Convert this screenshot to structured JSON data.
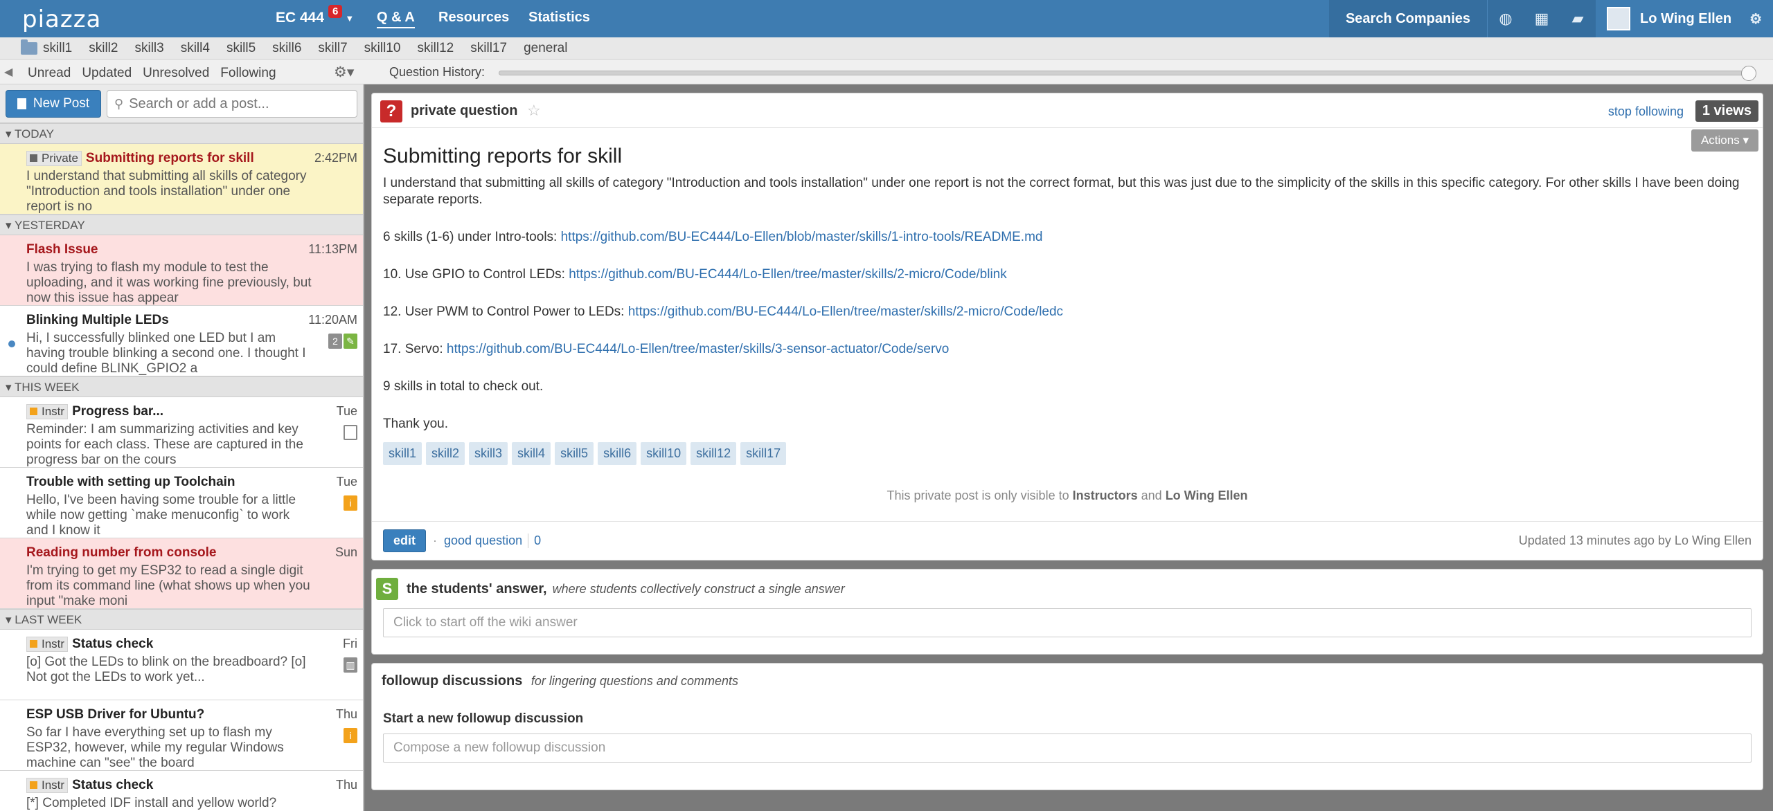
{
  "topbar": {
    "logo": "piazza",
    "course": "EC 444",
    "notif_count": "6",
    "nav": [
      "Q & A",
      "Resources",
      "Statistics"
    ],
    "search_companies": "Search Companies",
    "user_name": "Lo Wing Ellen"
  },
  "folders": [
    "skill1",
    "skill2",
    "skill3",
    "skill4",
    "skill5",
    "skill6",
    "skill7",
    "skill10",
    "skill12",
    "skill17",
    "general"
  ],
  "filters": [
    "Unread",
    "Updated",
    "Unresolved",
    "Following"
  ],
  "question_history_label": "Question History:",
  "sidebar": {
    "new_post": "New Post",
    "search_placeholder": "Search or add a post...",
    "groups": {
      "today": "TODAY",
      "yesterday": "YESTERDAY",
      "this_week": "THIS WEEK",
      "last_week": "LAST WEEK"
    },
    "posts": [
      {
        "tag": "Private",
        "title": "Submitting reports for skill",
        "snippet": "I understand that submitting all skills of category \"Introduction and tools installation\" under one report is no",
        "time": "2:42PM"
      },
      {
        "title": "Flash Issue",
        "snippet": "I was trying to flash my module to test the uploading, and it was working fine previously, but now this issue has appear",
        "time": "11:13PM"
      },
      {
        "title": "Blinking Multiple LEDs",
        "snippet": "Hi, I successfully blinked one LED but I am having trouble blinking a second one. I thought I could define BLINK_GPIO2 a",
        "time": "11:20AM",
        "count": "2"
      },
      {
        "tag": "Instr",
        "title": "Progress bar...",
        "snippet": "Reminder: I am summarizing activities and key points for each class. These are captured in the progress bar on the cours",
        "time": "Tue"
      },
      {
        "title": "Trouble with setting up Toolchain",
        "snippet": "Hello, I've been having some trouble for a little while now getting `make menuconfig` to work and I know it",
        "time": "Tue"
      },
      {
        "title": "Reading number from console",
        "snippet": "I'm trying to get my ESP32 to read a single digit from its command line (what shows up when you input \"make moni",
        "time": "Sun"
      },
      {
        "tag": "Instr",
        "title": "Status check",
        "snippet": "[o] Got the LEDs to blink on the breadboard? [o] Not got the LEDs to work yet...",
        "time": "Fri"
      },
      {
        "title": "ESP USB Driver for Ubuntu?",
        "snippet": "So far I have everything set up to flash my ESP32, however, while my regular Windows machine can \"see\" the board",
        "time": "Thu"
      },
      {
        "tag": "Instr",
        "title": "Status check",
        "snippet": "[*] Completed IDF install and yellow world?",
        "time": "Thu"
      }
    ]
  },
  "question": {
    "type": "private question",
    "stop_following": "stop following",
    "views": "1 views",
    "actions": "Actions",
    "title": "Submitting reports for skill",
    "intro": "I understand that submitting all skills of category \"Introduction and tools installation\" under one report is not the correct format, but this was just due to the simplicity of the skills in this specific category. For other skills I have been doing separate reports.",
    "lines": [
      {
        "label": "6 skills (1-6) under Intro-tools: ",
        "link": "https://github.com/BU-EC444/Lo-Ellen/blob/master/skills/1-intro-tools/README.md"
      },
      {
        "label": "10. Use GPIO to Control LEDs: ",
        "link": "https://github.com/BU-EC444/Lo-Ellen/tree/master/skills/2-micro/Code/blink"
      },
      {
        "label": "12. User PWM to Control Power to LEDs: ",
        "link": "https://github.com/BU-EC444/Lo-Ellen/tree/master/skills/2-micro/Code/ledc"
      },
      {
        "label": "17. Servo: ",
        "link": "https://github.com/BU-EC444/Lo-Ellen/tree/master/skills/3-sensor-actuator/Code/servo"
      }
    ],
    "total": "9 skills in total to check out.",
    "thanks": "Thank you.",
    "tags": [
      "skill1",
      "skill2",
      "skill3",
      "skill4",
      "skill5",
      "skill6",
      "skill10",
      "skill12",
      "skill17"
    ],
    "private_note": {
      "pre": "This private post is only visible to ",
      "who1": "Instructors",
      "mid": " and ",
      "who2": "Lo Wing Ellen"
    },
    "edit": "edit",
    "good_question": "good question",
    "good_count": "0",
    "updated": "Updated 13 minutes ago by Lo Wing Ellen"
  },
  "answer": {
    "title": "the students' answer,",
    "subtitle": "where students collectively construct a single answer",
    "placeholder": "Click to start off the wiki answer"
  },
  "followup": {
    "title": "followup discussions",
    "subtitle": "for lingering questions and comments",
    "start": "Start a new followup discussion",
    "placeholder": "Compose a new followup discussion"
  }
}
